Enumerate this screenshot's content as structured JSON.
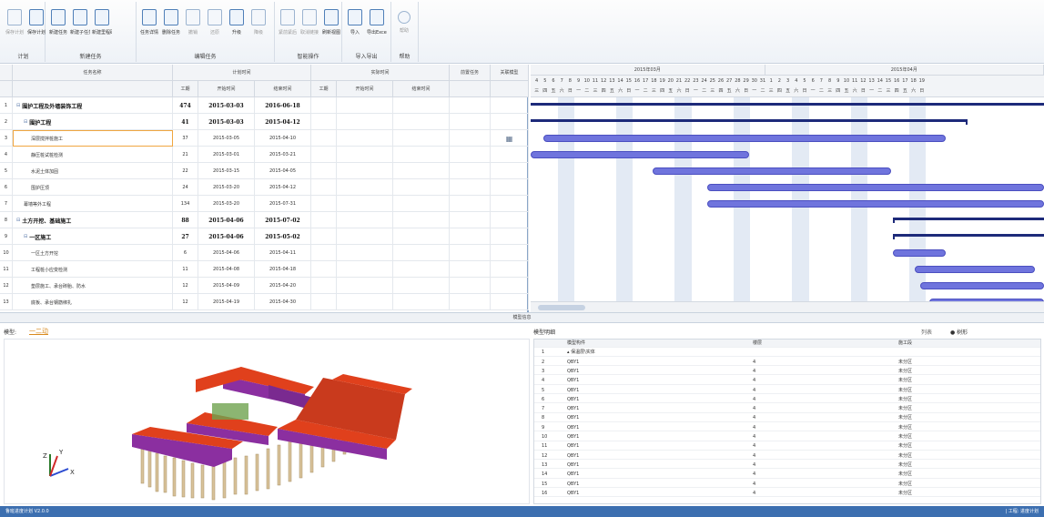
{
  "ribbon": {
    "groups": [
      {
        "label": "计划",
        "buttons": [
          {
            "label": "保存计划",
            "dim": true
          },
          {
            "label": "保存计划",
            "dim": false
          }
        ]
      },
      {
        "label": "新建任务",
        "buttons": [
          {
            "label": "新建任务",
            "dim": false
          },
          {
            "label": "新建子任务",
            "dim": false
          },
          {
            "label": "新建里程碑",
            "dim": false
          }
        ]
      },
      {
        "label": "编辑任务",
        "buttons": [
          {
            "label": "任务详情",
            "dim": false
          },
          {
            "label": "删除任务",
            "dim": false
          },
          {
            "label": "撤销",
            "dim": true
          },
          {
            "label": "还原",
            "dim": true
          },
          {
            "label": "升级",
            "dim": false
          },
          {
            "label": "降级",
            "dim": true
          }
        ]
      },
      {
        "label": "智能操作",
        "buttons": [
          {
            "label": "紧前紧后",
            "dim": true
          },
          {
            "label": "取消链接",
            "dim": true
          },
          {
            "label": "刷新视图",
            "dim": false
          }
        ]
      },
      {
        "label": "导入导出",
        "buttons": [
          {
            "label": "导入",
            "dim": false
          },
          {
            "label": "导出Excel",
            "dim": false
          }
        ]
      },
      {
        "label": "帮助",
        "buttons": [
          {
            "label": "帮助",
            "dim": true
          }
        ]
      }
    ]
  },
  "grid": {
    "headers": {
      "task_name": "任务名称",
      "planned_group": "计划时间",
      "actual_group": "实际时间",
      "duration": "工期",
      "start": "开始时间",
      "finish": "结束时间",
      "actual_duration": "工期",
      "actual_start": "开始时间",
      "actual_finish": "结束时间",
      "scope": "前置任务",
      "linked_model": "关联模型"
    },
    "rows": [
      {
        "id": "1",
        "name": "围护工程及外墙装饰工程",
        "indent": 0,
        "tree": "⊟",
        "bold": true,
        "duration": "474",
        "start": "2015-03-03",
        "finish": "2016-06-18",
        "model": ""
      },
      {
        "id": "2",
        "name": "围护工程",
        "indent": 1,
        "tree": "⊟",
        "bold": true,
        "duration": "41",
        "start": "2015-03-03",
        "finish": "2015-04-12",
        "model": ""
      },
      {
        "id": "3",
        "name": "深层搅拌桩施工",
        "indent": 2,
        "tree": "",
        "bold": false,
        "duration": "37",
        "start": "2015-03-05",
        "finish": "2015-04-10",
        "model": "▦",
        "selected": true
      },
      {
        "id": "4",
        "name": "静压桩试桩检测",
        "indent": 2,
        "tree": "",
        "bold": false,
        "duration": "21",
        "start": "2015-03-01",
        "finish": "2015-03-21",
        "model": ""
      },
      {
        "id": "5",
        "name": "水泥土体加固",
        "indent": 2,
        "tree": "",
        "bold": false,
        "duration": "22",
        "start": "2015-03-15",
        "finish": "2015-04-05",
        "model": ""
      },
      {
        "id": "6",
        "name": "围护压顶",
        "indent": 2,
        "tree": "",
        "bold": false,
        "duration": "24",
        "start": "2015-03-20",
        "finish": "2015-04-12",
        "model": ""
      },
      {
        "id": "7",
        "name": "幕墙等外工程",
        "indent": 1,
        "tree": "",
        "bold": false,
        "duration": "134",
        "start": "2015-03-20",
        "finish": "2015-07-31",
        "model": ""
      },
      {
        "id": "8",
        "name": "土方开挖、基础施工",
        "indent": 0,
        "tree": "⊟",
        "bold": true,
        "duration": "88",
        "start": "2015-04-06",
        "finish": "2015-07-02",
        "model": ""
      },
      {
        "id": "9",
        "name": "一区施工",
        "indent": 1,
        "tree": "⊟",
        "bold": true,
        "duration": "27",
        "start": "2015-04-06",
        "finish": "2015-05-02",
        "model": ""
      },
      {
        "id": "10",
        "name": "一区土方开挖",
        "indent": 2,
        "tree": "",
        "bold": false,
        "duration": "6",
        "start": "2015-04-06",
        "finish": "2015-04-11",
        "model": ""
      },
      {
        "id": "11",
        "name": "工程桩小应变检测",
        "indent": 2,
        "tree": "",
        "bold": false,
        "duration": "11",
        "start": "2015-04-08",
        "finish": "2015-04-18",
        "model": ""
      },
      {
        "id": "12",
        "name": "垫层施工、承台砖胎、防水",
        "indent": 2,
        "tree": "",
        "bold": false,
        "duration": "12",
        "start": "2015-04-09",
        "finish": "2015-04-20",
        "model": ""
      },
      {
        "id": "13",
        "name": "底板、承台钢筋绑扎",
        "indent": 2,
        "tree": "",
        "bold": false,
        "duration": "12",
        "start": "2015-04-19",
        "finish": "2015-04-30",
        "model": ""
      }
    ]
  },
  "gantt": {
    "months": [
      {
        "label": "2015年03月"
      },
      {
        "label": "2015年04月"
      }
    ],
    "days": [
      "4",
      "5",
      "6",
      "7",
      "8",
      "9",
      "10",
      "11",
      "12",
      "13",
      "14",
      "15",
      "16",
      "17",
      "18",
      "19",
      "20",
      "21",
      "22",
      "23",
      "24",
      "25",
      "26",
      "27",
      "28",
      "29",
      "30",
      "31",
      "1",
      "2",
      "3",
      "4",
      "5",
      "6",
      "7",
      "8",
      "9",
      "10",
      "11",
      "12",
      "13",
      "14",
      "15",
      "16",
      "17",
      "18",
      "19"
    ],
    "weekdays": [
      "三",
      "四",
      "五",
      "六",
      "日",
      "一",
      "二",
      "三",
      "四",
      "五",
      "六",
      "日",
      "一",
      "二",
      "三",
      "四",
      "五",
      "六",
      "日",
      "一",
      "二",
      "三",
      "四",
      "五",
      "六",
      "日",
      "一",
      "二",
      "三",
      "四",
      "五",
      "六",
      "日",
      "一",
      "二",
      "三",
      "四",
      "五",
      "六",
      "日",
      "一",
      "二",
      "三",
      "四",
      "五",
      "六",
      "日"
    ]
  },
  "splitter_label": "模型信息",
  "model_view": {
    "label": "模型:",
    "link": "一二动"
  },
  "model_table": {
    "title": "模型明细",
    "radio_list": "列表",
    "radio_tree": "● 树形",
    "headers": [
      "模型构件",
      "楼层",
      "施工段"
    ],
    "rows": [
      {
        "n": "1",
        "name": "▴ 保温层\\实体",
        "floor": "",
        "zone": ""
      },
      {
        "n": "2",
        "name": "QBY1",
        "floor": "4",
        "zone": "未分区"
      },
      {
        "n": "3",
        "name": "QBY1",
        "floor": "4",
        "zone": "未分区"
      },
      {
        "n": "4",
        "name": "QBY1",
        "floor": "4",
        "zone": "未分区"
      },
      {
        "n": "5",
        "name": "QBY1",
        "floor": "4",
        "zone": "未分区"
      },
      {
        "n": "6",
        "name": "QBY1",
        "floor": "4",
        "zone": "未分区"
      },
      {
        "n": "7",
        "name": "QBY1",
        "floor": "4",
        "zone": "未分区"
      },
      {
        "n": "8",
        "name": "QBY1",
        "floor": "4",
        "zone": "未分区"
      },
      {
        "n": "9",
        "name": "QBY1",
        "floor": "4",
        "zone": "未分区"
      },
      {
        "n": "10",
        "name": "QBY1",
        "floor": "4",
        "zone": "未分区"
      },
      {
        "n": "11",
        "name": "QBY1",
        "floor": "4",
        "zone": "未分区"
      },
      {
        "n": "12",
        "name": "QBY1",
        "floor": "4",
        "zone": "未分区"
      },
      {
        "n": "13",
        "name": "QBY1",
        "floor": "4",
        "zone": "未分区"
      },
      {
        "n": "14",
        "name": "QBY1",
        "floor": "4",
        "zone": "未分区"
      },
      {
        "n": "15",
        "name": "QBY1",
        "floor": "4",
        "zone": "未分区"
      },
      {
        "n": "16",
        "name": "QBY1",
        "floor": "4",
        "zone": "未分区"
      }
    ]
  },
  "status": {
    "left": "鲁班进度计划 V2.0.0",
    "right": "| 工程: 进度计划"
  },
  "colors": {
    "bar": "#6f74dd",
    "summary": "#1d2a7a",
    "building_roof": "#e0401c",
    "building_wall": "#8b2fa0",
    "piles": "#d8c29a",
    "statusbar": "#3c6fb0"
  }
}
